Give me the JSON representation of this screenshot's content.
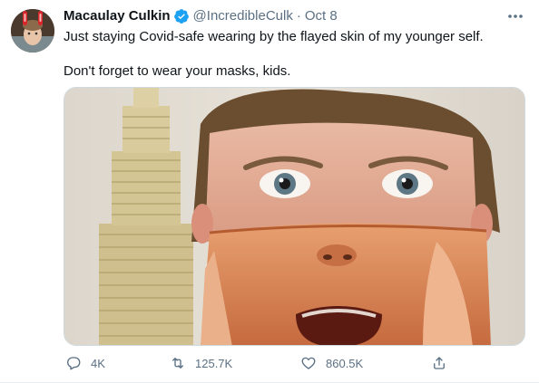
{
  "tweet": {
    "author_name": "Macaulay Culkin",
    "handle": "@IncredibleCulk",
    "separator": "·",
    "timestamp": "Oct 8",
    "text_line1": "Just staying Covid-safe wearing by the flayed skin of my younger self.",
    "text_line2": "Don't forget to wear your masks, kids.",
    "verified": true
  },
  "actions": {
    "reply_count": "4K",
    "retweet_count": "125.7K",
    "like_count": "860.5K"
  },
  "icons": {
    "verified": "verified-badge-icon",
    "more": "more-options-icon",
    "reply": "reply-icon",
    "retweet": "retweet-icon",
    "like": "heart-icon",
    "share": "share-icon"
  },
  "colors": {
    "text_primary": "#0f1419",
    "text_secondary": "#5b7083",
    "verified_blue": "#1da1f2",
    "border": "#cfd9de"
  }
}
